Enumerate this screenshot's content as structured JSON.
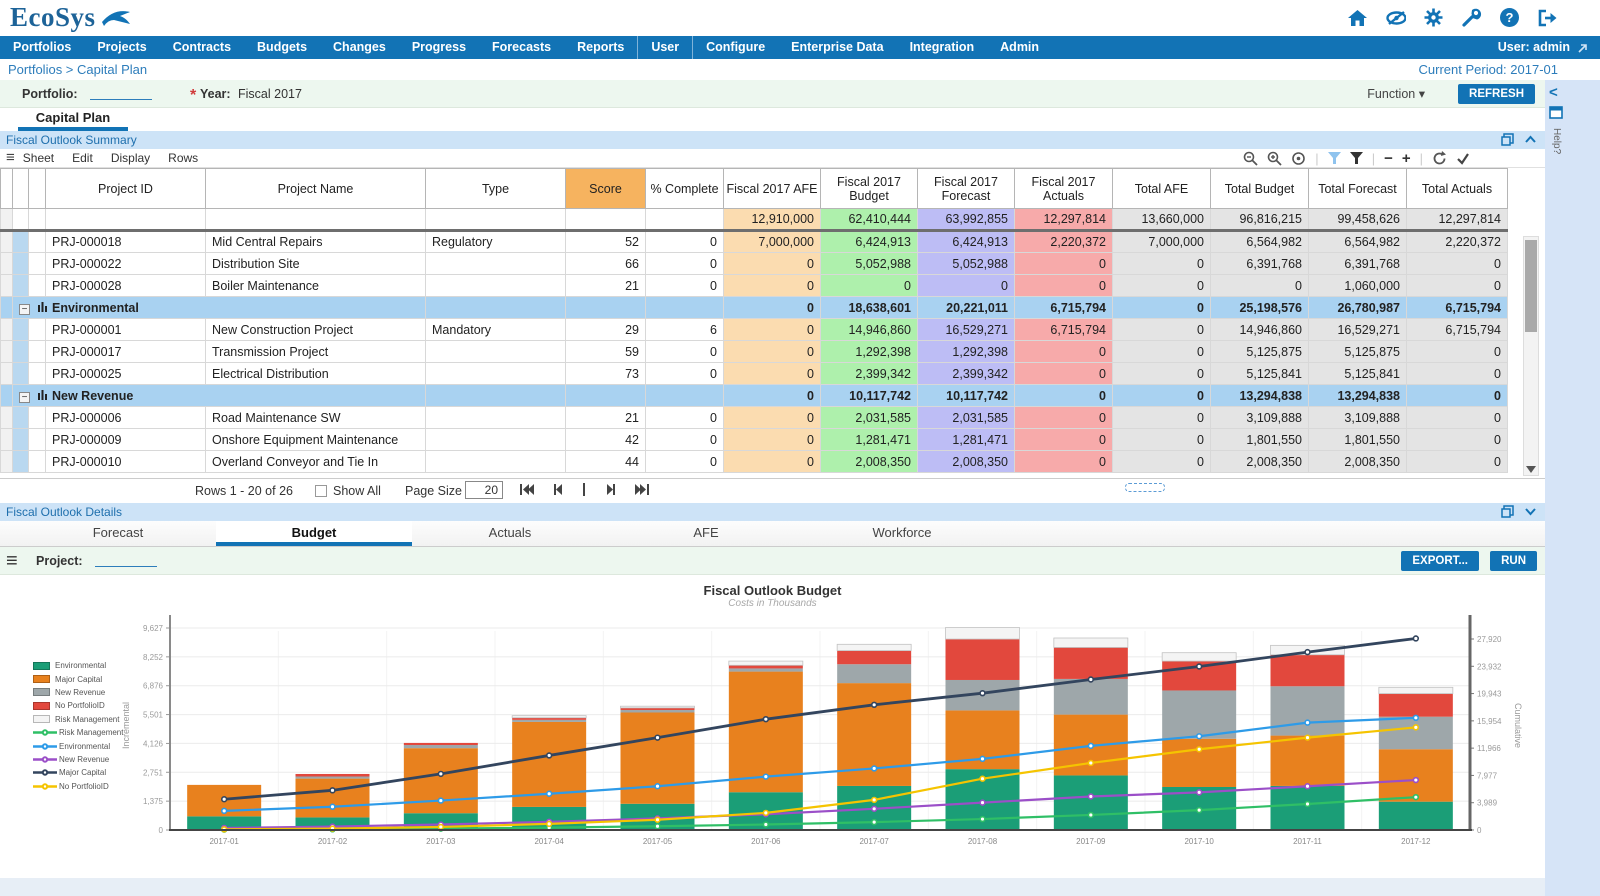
{
  "header": {
    "logo_text": "EcoSys",
    "icons": [
      "home",
      "visibility",
      "settings",
      "tools",
      "help",
      "logout"
    ],
    "user_label": "User: admin"
  },
  "nav": {
    "items": [
      "Portfolios",
      "Projects",
      "Contracts",
      "Budgets",
      "Changes",
      "Progress",
      "Forecasts",
      "Reports",
      "User",
      "Configure",
      "Enterprise Data",
      "Integration",
      "Admin"
    ]
  },
  "breadcrumb": {
    "path": "Portfolios > Capital Plan",
    "current_period": "Current Period: 2017-01"
  },
  "controls": {
    "portfolio_label": "Portfolio:",
    "year_required_mark": "*",
    "year_label": "Year:",
    "year_value": "Fiscal 2017",
    "function_label": "Function ▾",
    "refresh_label": "REFRESH"
  },
  "main_tab": {
    "label": "Capital Plan"
  },
  "summary_panel": {
    "title": "Fiscal Outlook Summary",
    "menu": [
      "Sheet",
      "Edit",
      "Display",
      "Rows"
    ],
    "toolbar_icons": [
      "zoom-out",
      "zoom-in",
      "target",
      "filter-active",
      "filter",
      "collapse-minus",
      "expand-plus",
      "refresh",
      "apply-check"
    ],
    "window_icons": [
      "restore",
      "collapse-up"
    ],
    "columns": [
      "Project ID",
      "Project Name",
      "Type",
      "Score",
      "% Complete",
      "Fiscal 2017 AFE",
      "Fiscal 2017 Budget",
      "Fiscal 2017 Forecast",
      "Fiscal 2017 Actuals",
      "Total AFE",
      "Total Budget",
      "Total Forecast",
      "Total Actuals"
    ],
    "totals": [
      "12,910,000",
      "62,410,444",
      "63,992,855",
      "12,297,814",
      "13,660,000",
      "96,816,215",
      "99,458,626",
      "12,297,814"
    ],
    "rows": [
      {
        "kind": "project",
        "id": "PRJ-000018",
        "name": "Mid Central Repairs",
        "type": "Regulatory",
        "score": "52",
        "complete": "0",
        "values": [
          "7,000,000",
          "6,424,913",
          "6,424,913",
          "2,220,372",
          "7,000,000",
          "6,564,982",
          "6,564,982",
          "2,220,372"
        ]
      },
      {
        "kind": "project",
        "id": "PRJ-000022",
        "name": "Distribution Site",
        "type": "",
        "score": "66",
        "complete": "0",
        "values": [
          "0",
          "5,052,988",
          "5,052,988",
          "0",
          "0",
          "6,391,768",
          "6,391,768",
          "0"
        ]
      },
      {
        "kind": "project",
        "id": "PRJ-000028",
        "name": "Boiler Maintenance",
        "type": "",
        "score": "21",
        "complete": "0",
        "values": [
          "0",
          "0",
          "0",
          "0",
          "0",
          "0",
          "1,060,000",
          "0"
        ]
      },
      {
        "kind": "group",
        "name": "Environmental",
        "values": [
          "0",
          "18,638,601",
          "20,221,011",
          "6,715,794",
          "0",
          "25,198,576",
          "26,780,987",
          "6,715,794"
        ]
      },
      {
        "kind": "project",
        "id": "PRJ-000001",
        "name": "New Construction Project",
        "type": "Mandatory",
        "score": "29",
        "complete": "6",
        "values": [
          "0",
          "14,946,860",
          "16,529,271",
          "6,715,794",
          "0",
          "14,946,860",
          "16,529,271",
          "6,715,794"
        ]
      },
      {
        "kind": "project",
        "id": "PRJ-000017",
        "name": "Transmission Project",
        "type": "",
        "score": "59",
        "complete": "0",
        "values": [
          "0",
          "1,292,398",
          "1,292,398",
          "0",
          "0",
          "5,125,875",
          "5,125,875",
          "0"
        ]
      },
      {
        "kind": "project",
        "id": "PRJ-000025",
        "name": "Electrical Distribution",
        "type": "",
        "score": "73",
        "complete": "0",
        "values": [
          "0",
          "2,399,342",
          "2,399,342",
          "0",
          "0",
          "5,125,841",
          "5,125,841",
          "0"
        ]
      },
      {
        "kind": "group",
        "name": "New Revenue",
        "values": [
          "0",
          "10,117,742",
          "10,117,742",
          "0",
          "0",
          "13,294,838",
          "13,294,838",
          "0"
        ]
      },
      {
        "kind": "project",
        "id": "PRJ-000006",
        "name": "Road Maintenance SW",
        "type": "",
        "score": "21",
        "complete": "0",
        "values": [
          "0",
          "2,031,585",
          "2,031,585",
          "0",
          "0",
          "3,109,888",
          "3,109,888",
          "0"
        ]
      },
      {
        "kind": "project",
        "id": "PRJ-000009",
        "name": "Onshore Equipment Maintenance",
        "type": "",
        "score": "42",
        "complete": "0",
        "values": [
          "0",
          "1,281,471",
          "1,281,471",
          "0",
          "0",
          "1,801,550",
          "1,801,550",
          "0"
        ]
      },
      {
        "kind": "project",
        "id": "PRJ-000010",
        "name": "Overland Conveyor and Tie In",
        "type": "",
        "score": "44",
        "complete": "0",
        "values": [
          "0",
          "2,008,350",
          "2,008,350",
          "0",
          "0",
          "2,008,350",
          "2,008,350",
          "0"
        ]
      }
    ],
    "pagination": {
      "rows_label": "Rows 1 - 20 of 26",
      "show_all_label": "Show All",
      "page_size_label": "Page Size",
      "page_size_value": "20",
      "pager_icons": [
        "first-page",
        "previous-page",
        "separator",
        "next-page",
        "last-page"
      ]
    }
  },
  "details_panel": {
    "title": "Fiscal Outlook Details",
    "tabs": [
      "Forecast",
      "Budget",
      "Actuals",
      "AFE",
      "Workforce"
    ],
    "active_tab": "Budget",
    "project_label": "Project:",
    "export_label": "EXPORT...",
    "run_label": "RUN",
    "window_icons": [
      "restore",
      "collapse-down"
    ]
  },
  "right_strip": {
    "help_label": "Help?"
  },
  "chart_data": {
    "type": "bar",
    "title": "Fiscal Outlook Budget",
    "subtitle": "Costs in Thousands",
    "categories": [
      "2017-01",
      "2017-02",
      "2017-03",
      "2017-04",
      "2017-05",
      "2017-06",
      "2017-07",
      "2017-08",
      "2017-09",
      "2017-10",
      "2017-11",
      "2017-12"
    ],
    "bar_series": [
      {
        "name": "Environmental",
        "color": "#1B9E77",
        "values": [
          650,
          600,
          800,
          1100,
          1250,
          1800,
          2100,
          2900,
          2600,
          2050,
          2100,
          1350
        ]
      },
      {
        "name": "Major Capital",
        "color": "#E8811E",
        "values": [
          1500,
          1850,
          3100,
          4050,
          4350,
          5750,
          4900,
          2800,
          2900,
          2300,
          2400,
          2500
        ]
      },
      {
        "name": "New Revenue",
        "color": "#9EA7AA",
        "values": [
          0,
          100,
          150,
          100,
          120,
          150,
          900,
          1450,
          1700,
          2300,
          2350,
          1550
        ]
      },
      {
        "name": "No PortfolioID",
        "color": "#E2483D",
        "values": [
          0,
          120,
          100,
          100,
          100,
          150,
          650,
          1950,
          1500,
          1400,
          1500,
          1100
        ]
      },
      {
        "name": "Risk Management",
        "color": "#F4F4F4",
        "values": [
          0,
          0,
          0,
          100,
          80,
          200,
          300,
          550,
          450,
          400,
          450,
          300
        ]
      }
    ],
    "line_series": [
      {
        "name": "Risk Management",
        "color": "#2FBF66",
        "values": [
          50,
          100,
          200,
          350,
          550,
          800,
          1150,
          1600,
          2200,
          2900,
          3800,
          4800
        ]
      },
      {
        "name": "Environmental",
        "color": "#2E9BE8",
        "values": [
          2800,
          3400,
          4300,
          5300,
          6400,
          7800,
          9000,
          10400,
          12300,
          13700,
          15700,
          16400
        ]
      },
      {
        "name": "New Revenue",
        "color": "#9B4FC8",
        "values": [
          300,
          500,
          800,
          1200,
          1700,
          2300,
          3100,
          4000,
          4900,
          5500,
          6400,
          7300
        ]
      },
      {
        "name": "Major Capital",
        "color": "#33455E",
        "values": [
          4500,
          5800,
          8200,
          10900,
          13500,
          16200,
          18300,
          20000,
          22000,
          23900,
          26000,
          28000
        ]
      },
      {
        "name": "No PortfolioID",
        "color": "#F5C400",
        "values": [
          100,
          200,
          450,
          900,
          1500,
          2500,
          4400,
          7500,
          9800,
          11800,
          13500,
          15000
        ]
      }
    ],
    "legend": [
      {
        "label": "Environmental",
        "type": "bar",
        "color": "#1B9E77"
      },
      {
        "label": "Major Capital",
        "type": "bar",
        "color": "#E8811E"
      },
      {
        "label": "New Revenue",
        "type": "bar",
        "color": "#9EA7AA"
      },
      {
        "label": "No PortfolioID",
        "type": "bar",
        "color": "#E2483D"
      },
      {
        "label": "Risk Management",
        "type": "bar",
        "color": "#F4F4F4"
      },
      {
        "label": "Risk Management",
        "type": "line",
        "color": "#2FBF66"
      },
      {
        "label": "Environmental",
        "type": "line",
        "color": "#2E9BE8"
      },
      {
        "label": "New Revenue",
        "type": "line",
        "color": "#9B4FC8"
      },
      {
        "label": "Major Capital",
        "type": "line",
        "color": "#33455E"
      },
      {
        "label": "No PortfolioID",
        "type": "line",
        "color": "#F5C400"
      }
    ],
    "left_axis": {
      "label": "Incremental",
      "ticks": [
        0,
        1375,
        2751,
        4126,
        5501,
        6876,
        8252,
        9627
      ],
      "max": 9627
    },
    "right_axis": {
      "label": "Cumulative",
      "ticks": [
        0,
        3989,
        7977,
        11966,
        15954,
        19943,
        23932,
        27920
      ],
      "max": 27920
    },
    "grid": true,
    "legend_position": "left"
  },
  "colors": {
    "brand_blue": "#1273b5",
    "panel_header_bg": "#cde3f7",
    "score_header_bg": "#f6b35f",
    "afe_cell": "#fbdcb0",
    "budget_cell": "#aef0ac",
    "forecast_cell": "#bdbdf5",
    "actuals_cell": "#f7aaaa",
    "total_cell": "#e4e4e4",
    "group_row_bg": "#a9d2f1",
    "control_bar_bg": "#edf7ef"
  }
}
